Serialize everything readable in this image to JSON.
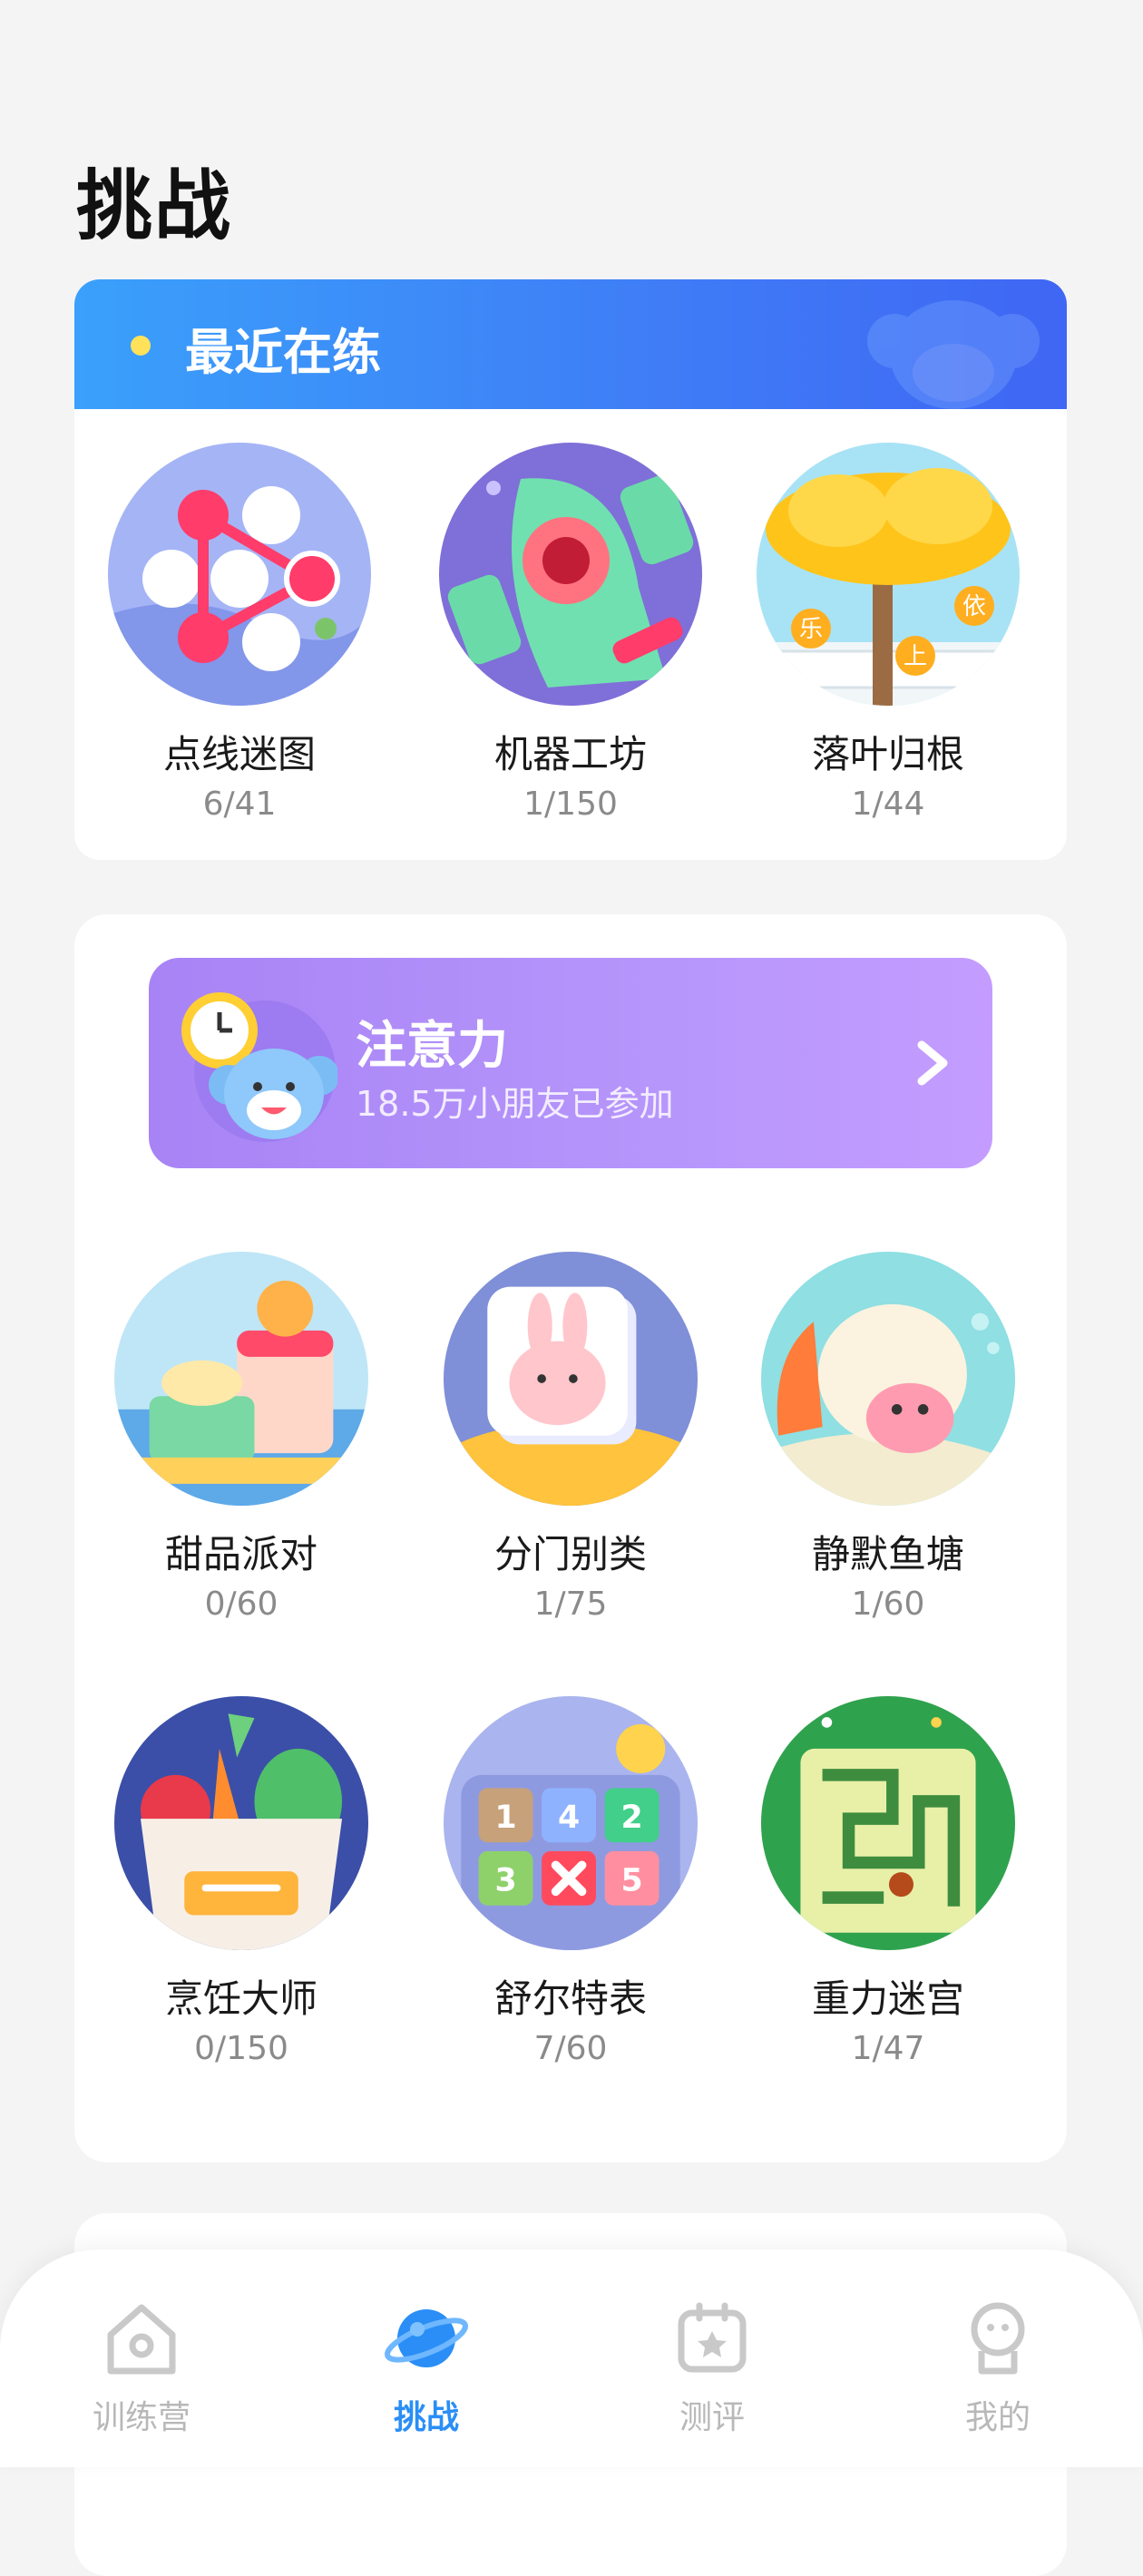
{
  "page": {
    "title": "挑战"
  },
  "recent": {
    "title": "最近在练",
    "games": [
      {
        "name": "点线迷图",
        "progress": "6/41"
      },
      {
        "name": "机器工坊",
        "progress": "1/150"
      },
      {
        "name": "落叶归根",
        "progress": "1/44"
      }
    ]
  },
  "attention": {
    "title": "注意力",
    "subtitle": "18.5万小朋友已参加",
    "games": [
      {
        "name": "甜品派对",
        "progress": "0/60"
      },
      {
        "name": "分门别类",
        "progress": "1/75"
      },
      {
        "name": "静默鱼塘",
        "progress": "1/60"
      },
      {
        "name": "烹饪大师",
        "progress": "0/150"
      },
      {
        "name": "舒尔特表",
        "progress": "7/60"
      },
      {
        "name": "重力迷宫",
        "progress": "1/47"
      }
    ]
  },
  "leaf_tree_tags": [
    "乐",
    "上",
    "依"
  ],
  "schulte_numbers": [
    "1",
    "4",
    "2",
    "3",
    "5"
  ],
  "tabbar": {
    "active": "挑战",
    "tabs": [
      {
        "label": "训练营",
        "icon": "house-icon"
      },
      {
        "label": "挑战",
        "icon": "planet-icon"
      },
      {
        "label": "测评",
        "icon": "assessment-icon"
      },
      {
        "label": "我的",
        "icon": "profile-icon"
      }
    ]
  },
  "colors": {
    "accent_blue": "#2a8ef6",
    "banner_purple": "#b18df8",
    "header_blue": "#3f7cf6"
  }
}
